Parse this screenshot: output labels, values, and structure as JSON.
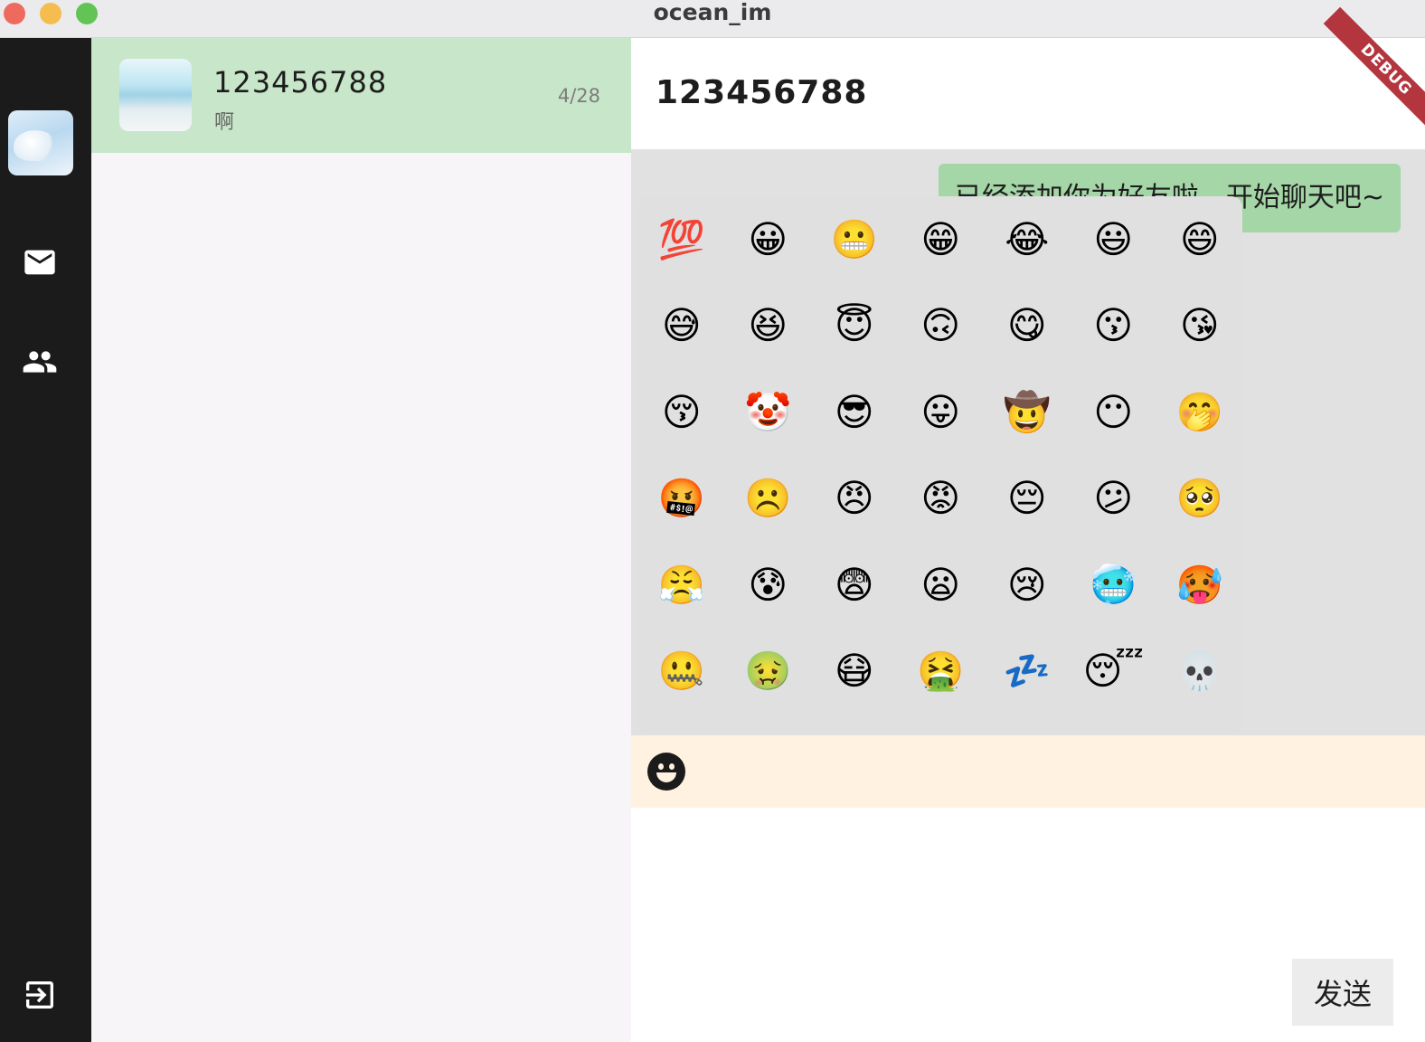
{
  "window": {
    "title": "ocean_im"
  },
  "rail": {
    "items": [
      {
        "name": "avatar"
      },
      {
        "name": "mail-icon"
      },
      {
        "name": "people-icon"
      },
      {
        "name": "logout-icon"
      }
    ]
  },
  "conversations": [
    {
      "name": "123456788",
      "last_message": "啊",
      "date": "4/28"
    }
  ],
  "chat": {
    "title": "123456788",
    "debug_label": "DEBUG",
    "messages": [
      {
        "text": "已经添加你为好友啦，开始聊天吧~",
        "from": "other"
      }
    ],
    "emojis": [
      "💯",
      "😀",
      "😬",
      "😁",
      "😂",
      "😃",
      "😄",
      "😅",
      "😆",
      "😇",
      "🙃",
      "😋",
      "😗",
      "😘",
      "😚",
      "🤡",
      "😎",
      "😛",
      "🤠",
      "😶",
      "🤭",
      "🤬",
      "☹️",
      "😠",
      "😡",
      "😔",
      "😕",
      "🥺",
      "😤",
      "😰",
      "😨",
      "😦",
      "😢",
      "🥶",
      "🥵",
      "🤐",
      "🤢",
      "😷",
      "🤮",
      "💤",
      "😴",
      "💀"
    ],
    "send_label": "发送"
  }
}
